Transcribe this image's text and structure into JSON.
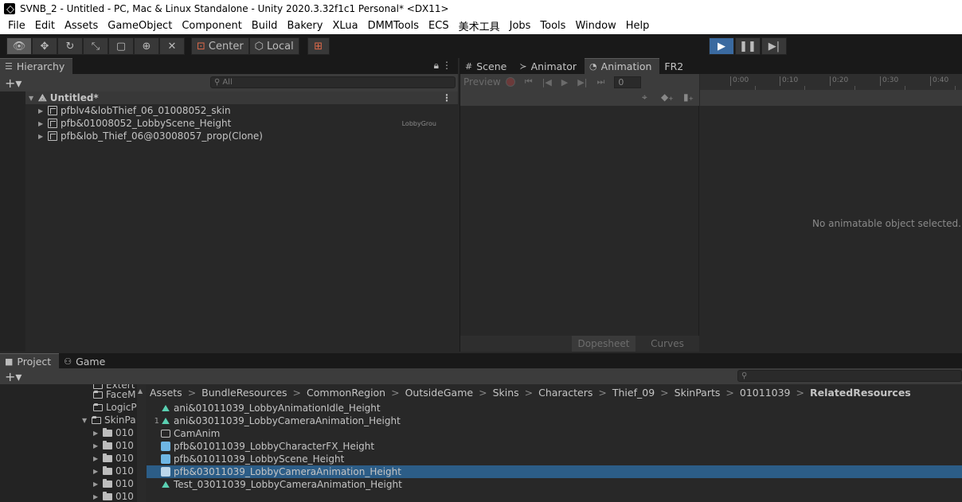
{
  "window": {
    "title": "SVNB_2 - Untitled - PC, Mac & Linux Standalone - Unity 2020.3.32f1c1 Personal* <DX11>"
  },
  "menu": [
    "File",
    "Edit",
    "Assets",
    "GameObject",
    "Component",
    "Build",
    "Bakery",
    "XLua",
    "DMMTools",
    "ECS",
    "美术工具",
    "Jobs",
    "Tools",
    "Window",
    "Help"
  ],
  "toolbar": {
    "pivot_label": "Center",
    "space_label": "Local"
  },
  "hierarchy": {
    "tab_label": "Hierarchy",
    "search_placeholder": "All",
    "scene_name": "Untitled*",
    "items": [
      {
        "label": "pfblv4&lobThief_06_01008052_skin",
        "tag": ""
      },
      {
        "label": "pfb&01008052_LobbyScene_Height",
        "tag": "LobbyGrou"
      },
      {
        "label": "pfb&lob_Thief_06@03008057_prop(Clone)",
        "tag": ""
      }
    ]
  },
  "animation_panel": {
    "tabs": [
      "Scene",
      "Animator",
      "Animation",
      "FR2"
    ],
    "preview_label": "Preview",
    "frame_value": "0",
    "timeline_ticks": [
      "0:00",
      "0:10",
      "0:20",
      "0:30",
      "0:40"
    ],
    "empty_message": "No animatable object selected.",
    "bottom_tabs": [
      "Dopesheet",
      "Curves"
    ]
  },
  "project": {
    "tabs": [
      "Project",
      "Game"
    ],
    "tree": [
      {
        "label": "Extert"
      },
      {
        "label": "FaceM"
      },
      {
        "label": "LogicP"
      },
      {
        "label": "SkinPa"
      },
      {
        "label": "010"
      },
      {
        "label": "010"
      },
      {
        "label": "010"
      },
      {
        "label": "010"
      },
      {
        "label": "010"
      },
      {
        "label": "010"
      }
    ],
    "breadcrumb": [
      "Assets",
      "BundleResources",
      "CommonRegion",
      "OutsideGame",
      "Skins",
      "Characters",
      "Thief_09",
      "SkinParts",
      "01011039",
      "RelatedResources"
    ],
    "assets": [
      {
        "label": "ani&01011039_LobbyAnimationIdle_Height",
        "icon": "animation-clip-icon",
        "num": ""
      },
      {
        "label": "ani&03011039_LobbyCameraAnimation_Height",
        "icon": "animation-clip-icon",
        "num": "1"
      },
      {
        "label": "CamAnim",
        "icon": "camera-anim-icon",
        "num": ""
      },
      {
        "label": "pfb&01011039_LobbyCharacterFX_Height",
        "icon": "prefab-icon",
        "num": ""
      },
      {
        "label": "pfb&01011039_LobbyScene_Height",
        "icon": "prefab-icon",
        "num": ""
      },
      {
        "label": "pfb&03011039_LobbyCameraAnimation_Height",
        "icon": "prefab-icon",
        "num": ""
      },
      {
        "label": "Test_03011039_LobbyCameraAnimation_Height",
        "icon": "animation-clip-icon",
        "num": ""
      }
    ]
  }
}
